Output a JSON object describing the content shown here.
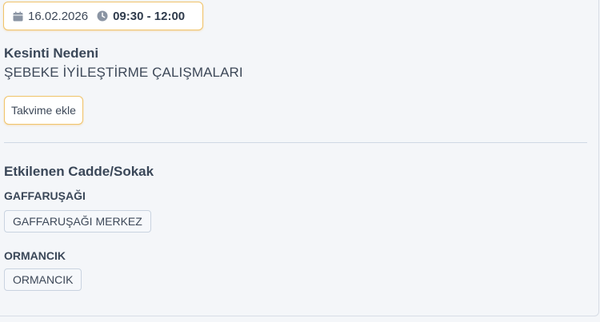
{
  "schedule": {
    "date": "16.02.2026",
    "time_range": "09:30 - 12:00"
  },
  "reason": {
    "title": "Kesinti Nedeni",
    "value": "ŞEBEKE İYİLEŞTİRME ÇALIŞMALARI"
  },
  "actions": {
    "add_to_calendar": "Takvime ekle"
  },
  "affected": {
    "title": "Etkilenen Cadde/Sokak",
    "districts": [
      {
        "name": "GAFFARUŞAĞI",
        "streets": [
          "GAFFARUŞAĞI MERKEZ"
        ]
      },
      {
        "name": "ORMANCIK",
        "streets": [
          "ORMANCIK"
        ]
      }
    ]
  },
  "icons": {
    "date": "calendar-icon",
    "time": "clock-icon"
  },
  "colors": {
    "accent_border": "#f0c46a",
    "tag_border": "#c9d3e0",
    "text": "#2f3b4c",
    "icon": "#8a94a3"
  }
}
